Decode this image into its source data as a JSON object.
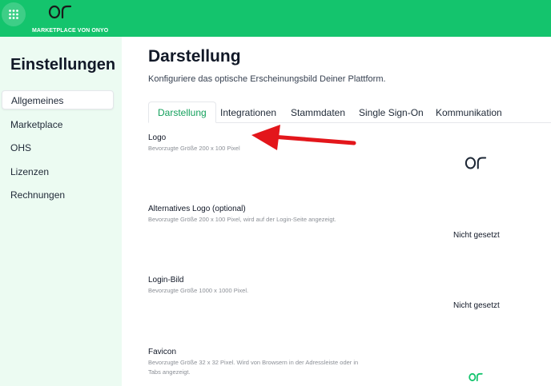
{
  "topbar": {
    "brand_name": "MARKETPLACE VON ONYO",
    "colors": {
      "brand_green": "#14c46d"
    }
  },
  "sidebar": {
    "title": "Einstellungen",
    "items": [
      {
        "label": "Allgemeines",
        "active": true
      },
      {
        "label": "Marketplace",
        "active": false
      },
      {
        "label": "OHS",
        "active": false
      },
      {
        "label": "Lizenzen",
        "active": false
      },
      {
        "label": "Rechnungen",
        "active": false
      }
    ]
  },
  "main": {
    "title": "Darstellung",
    "subtitle": "Konfiguriere das optische Erscheinungsbild Deiner Plattform.",
    "tabs": [
      {
        "label": "Darstellung",
        "active": true
      },
      {
        "label": "Integrationen",
        "active": false
      },
      {
        "label": "Stammdaten",
        "active": false
      },
      {
        "label": "Single Sign-On",
        "active": false
      },
      {
        "label": "Kommunikation",
        "active": false
      }
    ],
    "fields": [
      {
        "label": "Logo",
        "hint": "Bevorzugte Größe 200 x 100 Pixel",
        "value_type": "logo-dark"
      },
      {
        "label": "Alternatives Logo (optional)",
        "hint": "Bevorzugte Größe 200 x 100 Pixel, wird auf der Login-Seite angezeigt.",
        "value": "Nicht gesetzt"
      },
      {
        "label": "Login-Bild",
        "hint": "Bevorzugte Größe 1000 x 1000 Pixel.",
        "value": "Nicht gesetzt"
      },
      {
        "label": "Favicon",
        "hint": "Bevorzugte Größe 32 x 32 Pixel. Wird von Browsern in der Adressleiste oder in Tabs angezeigt.",
        "value_type": "logo-green"
      }
    ]
  },
  "annotation": {
    "arrow_color": "#e3161b"
  }
}
